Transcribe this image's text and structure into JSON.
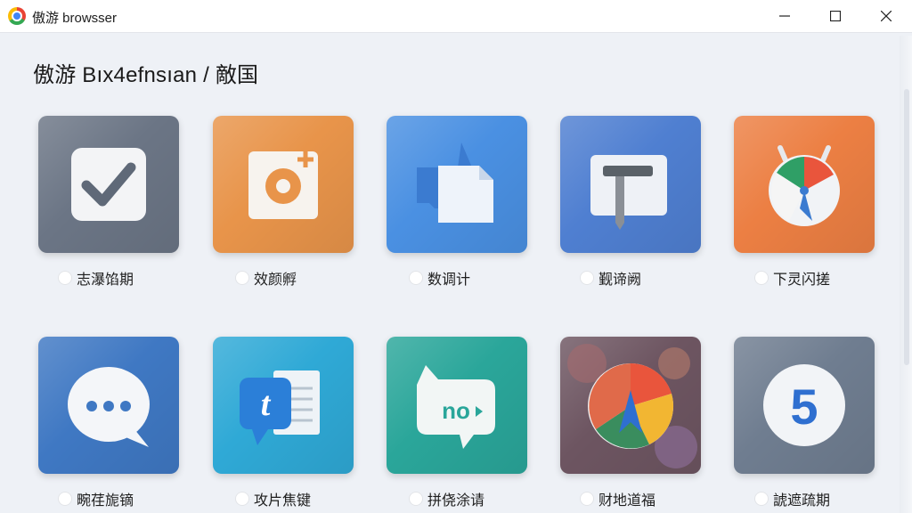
{
  "window": {
    "title": "傲游 browsser",
    "minimize_label": "—",
    "maximize_label": "☐",
    "close_label": "✕"
  },
  "panel": {
    "close_label": "×",
    "heading": "傲游 Bıx4efnsıan / 敵国"
  },
  "tiles": [
    {
      "label": "志瀑馅期",
      "icon": "check-icon",
      "color": "#6b7585"
    },
    {
      "label": "效颜孵",
      "icon": "photo-add-icon",
      "color": "#e8944a"
    },
    {
      "label": "数调计",
      "icon": "document-copy-icon",
      "color": "#4a90e2"
    },
    {
      "label": "觐谛阙",
      "icon": "tool-icon",
      "color": "#4f7fd1"
    },
    {
      "label": "下灵闪搓",
      "icon": "calendar-pie-icon",
      "color": "#ec7f43"
    },
    {
      "label": "畹荏旎镝",
      "icon": "chat-bubble-icon",
      "color": "#3f78c3"
    },
    {
      "label": "攻片焦键",
      "icon": "text-document-icon",
      "color": "#2fa9d6"
    },
    {
      "label": "拼侥涂请",
      "icon": "no-tag-icon",
      "color": "#2aa69a"
    },
    {
      "label": "财地道福",
      "icon": "compass-pie-icon",
      "color": "#6d5561"
    },
    {
      "label": "諕遮疏期",
      "icon": "number-five-icon",
      "color": "#6f7d90"
    }
  ]
}
